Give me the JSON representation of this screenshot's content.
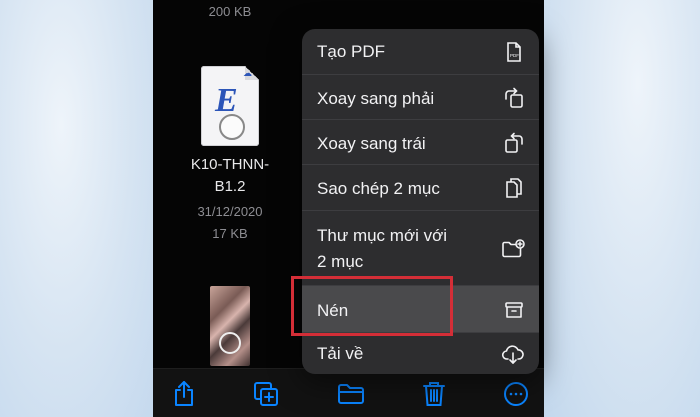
{
  "files": {
    "top_size": "200 KB",
    "doc": {
      "icon_letter": "E",
      "name_line1": "K10-THNN-",
      "name_line2": "B1.2",
      "date": "31/12/2020",
      "size": "17 KB"
    }
  },
  "menu": {
    "items": [
      {
        "label": "Tạo PDF",
        "icon": "pdf-doc-icon"
      },
      {
        "label": "Xoay sang phải",
        "icon": "rotate-right-icon"
      },
      {
        "label": "Xoay sang trái",
        "icon": "rotate-left-icon"
      },
      {
        "label": "Sao chép 2 mục",
        "icon": "copy-docs-icon"
      },
      {
        "label_line1": "Thư mục mới với",
        "label_line2": "2 mục",
        "icon": "new-folder-icon"
      },
      {
        "label": "Nén",
        "icon": "archive-box-icon"
      },
      {
        "label": "Tải về",
        "icon": "cloud-download-icon"
      }
    ]
  },
  "toolbar": {
    "buttons": [
      "share-icon",
      "duplicate-icon",
      "folder-icon",
      "trash-icon",
      "more-icon"
    ],
    "accent": "#0a84ff"
  },
  "colors": {
    "menu_bg": "#2d2d2f",
    "highlight": "#d42e37",
    "text": "#f2f2f4",
    "secondary_text": "#8d8d92"
  }
}
